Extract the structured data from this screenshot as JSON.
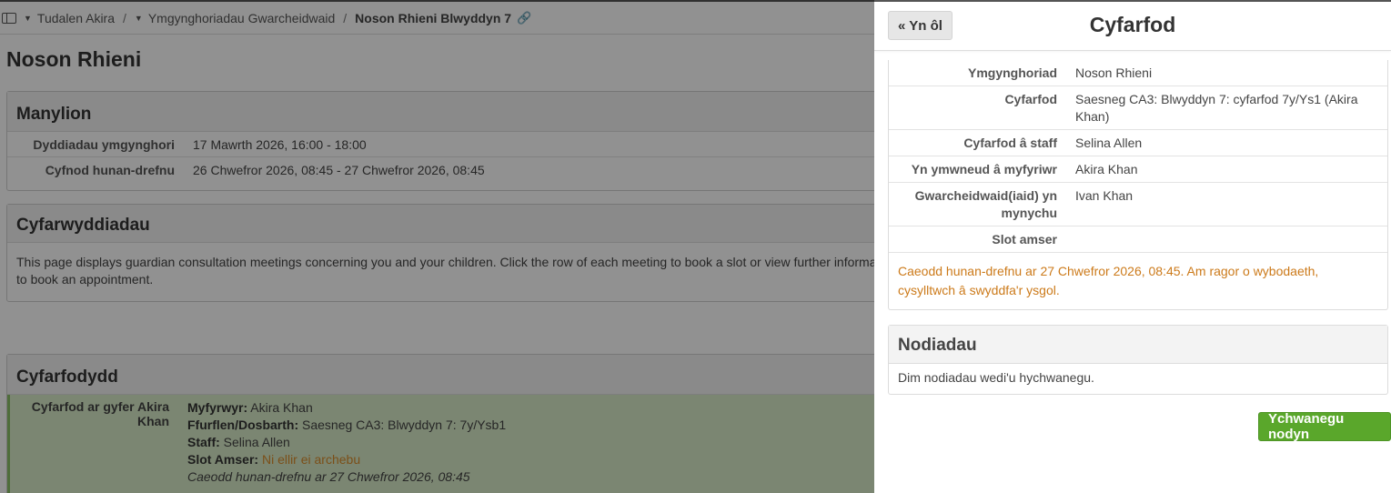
{
  "breadcrumb": {
    "items": [
      "Tudalen Akira",
      "Ymgynghoriadau Gwarcheidwaid",
      "Noson Rhieni Blwyddyn 7"
    ],
    "sep": "/",
    "link_icon": "link-icon"
  },
  "page_title": "Noson Rhieni",
  "details": {
    "heading": "Manylion",
    "rows": [
      {
        "label": "Dyddiadau ymgynghori",
        "value": "17 Mawrth 2026, 16:00 - 18:00"
      },
      {
        "label": "Cyfnod hunan-drefnu",
        "value": "26 Chwefror 2026, 08:45 - 27 Chwefror 2026, 08:45"
      }
    ]
  },
  "instructions": {
    "heading": "Cyfarwyddiadau",
    "text": "This page displays guardian consultation meetings concerning you and your children. Click the row of each meeting to book a slot or view further information. to book an appointment."
  },
  "meetings": {
    "heading": "Cyfarfodydd",
    "row_label": "Cyfarfod ar gyfer Akira Khan",
    "student_label": "Myfyrwyr:",
    "student": "Akira Khan",
    "form_label": "Ffurflen/Dosbarth:",
    "form": "Saesneg CA3: Blwyddyn 7: 7y/Ysb1",
    "staff_label": "Staff:",
    "staff": "Selina Allen",
    "slot_label": "Slot Amser:",
    "slot": "Ni ellir ei archebu",
    "closed": "Caeodd hunan-drefnu ar 27 Chwefror 2026, 08:45"
  },
  "drawer": {
    "back_label": "« Yn ôl",
    "title": "Cyfarfod",
    "rows": [
      {
        "label": "Ymgynghoriad",
        "value": "Noson Rhieni"
      },
      {
        "label": "Cyfarfod",
        "value": "Saesneg CA3: Blwyddyn 7: cyfarfod 7y/Ys1 (Akira Khan)"
      },
      {
        "label": "Cyfarfod â staff",
        "value": "Selina Allen"
      },
      {
        "label": "Yn ymwneud â myfyriwr",
        "value": "Akira Khan"
      },
      {
        "label": "Gwarcheidwaid(iaid) yn mynychu",
        "value": "Ivan Khan"
      },
      {
        "label": "Slot amser",
        "value": ""
      }
    ],
    "notice": "Caeodd hunan-drefnu ar 27 Chwefror 2026, 08:45. Am ragor o wybodaeth, cysylltwch â swyddfa'r ysgol.",
    "notes_heading": "Nodiadau",
    "notes_empty": "Dim nodiadau wedi'u hychwanegu.",
    "add_note_label": "Ychwanegu nodyn"
  },
  "colors": {
    "accent_green": "#5aa72b",
    "notice_orange": "#cc7a1a",
    "meeting_row_bg": "#d9ecc9"
  }
}
